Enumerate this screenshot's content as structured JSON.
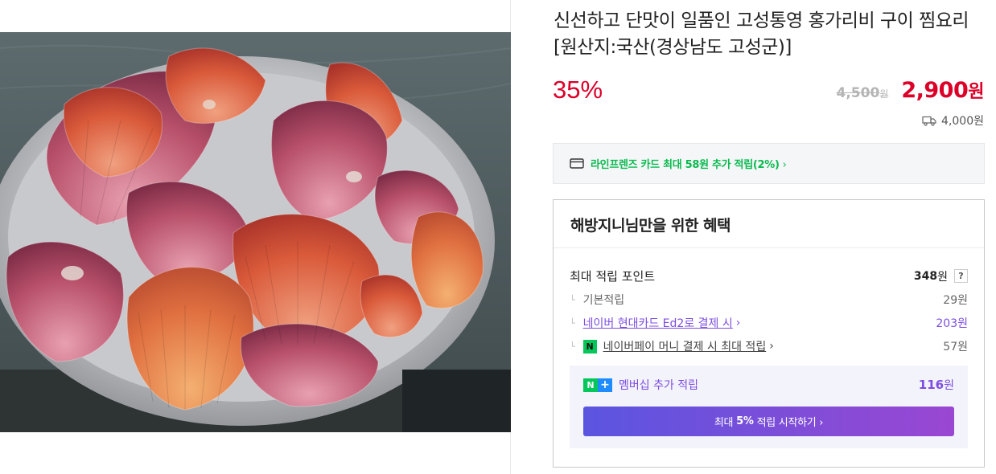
{
  "product": {
    "title": "신선하고 단맛이 일품인 고성통영 홍가리비 구이 찜요리 [원산지:국산(경상남도 고성군)]",
    "discount": "35%",
    "original_price": "4,500",
    "original_currency": "원",
    "sale_price": "2,900",
    "sale_currency": "원",
    "shipping": "4,000원"
  },
  "card_promo": {
    "text": "라인프렌즈 카드 최대 58원 추가 적립(2%)",
    "chevron": "›"
  },
  "benefit": {
    "header": "해방지니님만을 위한 혜택",
    "max_points_label": "최대 적립 포인트",
    "max_points_value": "348",
    "max_points_unit": "원",
    "help": "?",
    "rows": [
      {
        "label": "기본적립",
        "value": "29원"
      },
      {
        "label": "네이버 현대카드 Ed2로 결제 시",
        "value": "203원"
      },
      {
        "label": "네이버페이 머니 결제 시 최대 적립",
        "value": "57원"
      }
    ],
    "npay_badge": "N",
    "tree_mark": "└",
    "chevron": "›"
  },
  "membership": {
    "badge_n": "N",
    "badge_plus": "+",
    "label": "멤버십 추가 적립",
    "value": "116",
    "unit": "원",
    "button_prefix": "최대",
    "button_bold": "5%",
    "button_suffix": "적립 시작하기 ›"
  },
  "colors": {
    "discount_red": "#dc0029",
    "card_green": "#0abb4f",
    "naver_purple": "#7c4ee0",
    "button_gradient_start": "#5a55e0",
    "button_gradient_end": "#9a47d2"
  }
}
